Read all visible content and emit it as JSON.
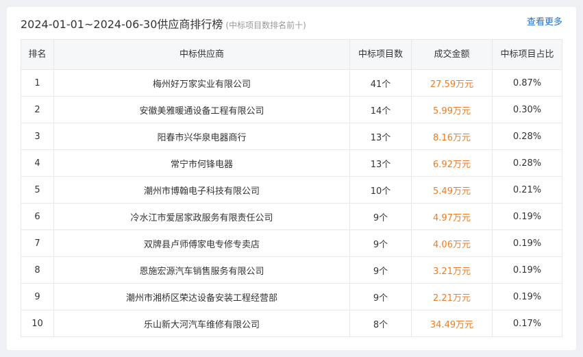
{
  "header": {
    "title": "2024-01-01~2024-06-30供应商排行榜",
    "subtitle": "(中标项目数排名前十)",
    "more_link": "查看更多"
  },
  "table": {
    "columns": [
      "排名",
      "中标供应商",
      "中标项目数",
      "成交金额",
      "中标项目占比"
    ],
    "rows": [
      {
        "rank": "1",
        "supplier": "梅州好万家实业有限公司",
        "count": "41个",
        "amount": "27.59万元",
        "ratio": "0.87%"
      },
      {
        "rank": "2",
        "supplier": "安徽美雅暖通设备工程有限公司",
        "count": "14个",
        "amount": "5.99万元",
        "ratio": "0.30%"
      },
      {
        "rank": "3",
        "supplier": "阳春市兴华泉电器商行",
        "count": "13个",
        "amount": "8.16万元",
        "ratio": "0.28%"
      },
      {
        "rank": "4",
        "supplier": "常宁市何锋电器",
        "count": "13个",
        "amount": "6.92万元",
        "ratio": "0.28%"
      },
      {
        "rank": "5",
        "supplier": "潮州市博翰电子科技有限公司",
        "count": "10个",
        "amount": "5.49万元",
        "ratio": "0.21%"
      },
      {
        "rank": "6",
        "supplier": "冷水江市爱居家政服务有限责任公司",
        "count": "9个",
        "amount": "4.97万元",
        "ratio": "0.19%"
      },
      {
        "rank": "7",
        "supplier": "双牌县卢师傅家电专修专卖店",
        "count": "9个",
        "amount": "4.06万元",
        "ratio": "0.19%"
      },
      {
        "rank": "8",
        "supplier": "恩施宏源汽车销售服务有限公司",
        "count": "9个",
        "amount": "3.21万元",
        "ratio": "0.19%"
      },
      {
        "rank": "9",
        "supplier": "潮州市湘桥区荣达设备安装工程经营部",
        "count": "9个",
        "amount": "2.21万元",
        "ratio": "0.19%"
      },
      {
        "rank": "10",
        "supplier": "乐山新大河汽车维修有限公司",
        "count": "8个",
        "amount": "34.49万元",
        "ratio": "0.17%"
      }
    ]
  },
  "colors": {
    "amount": "#f07b20",
    "link": "#1e6fcf",
    "header_bg": "#f6f7f9",
    "border": "#e8e8e8"
  }
}
